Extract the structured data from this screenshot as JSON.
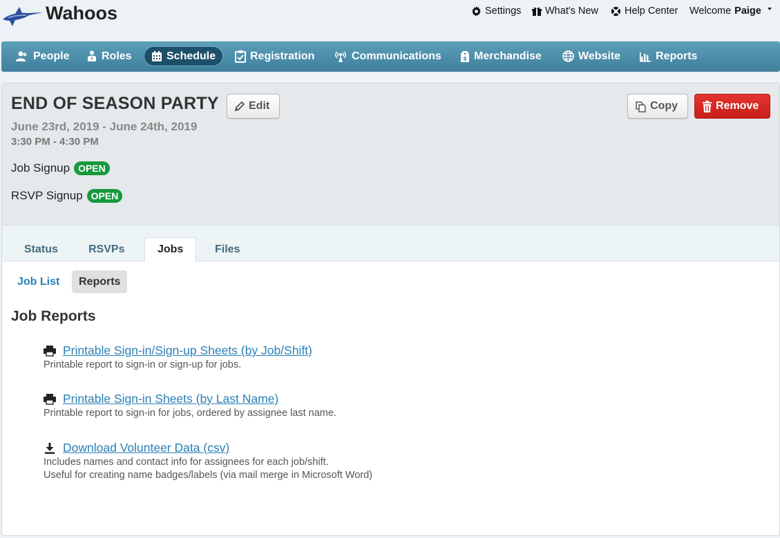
{
  "header": {
    "brand": "Wahoos",
    "settings": "Settings",
    "whats_new": "What's New",
    "help_center": "Help Center",
    "welcome": "Welcome",
    "user": "Paige"
  },
  "nav": {
    "items": [
      {
        "label": "People",
        "icon": "people-icon"
      },
      {
        "label": "Roles",
        "icon": "roles-icon"
      },
      {
        "label": "Schedule",
        "icon": "calendar-icon",
        "active": true
      },
      {
        "label": "Registration",
        "icon": "checklist-icon"
      },
      {
        "label": "Communications",
        "icon": "broadcast-icon"
      },
      {
        "label": "Merchandise",
        "icon": "price-tag-icon"
      },
      {
        "label": "Website",
        "icon": "globe-icon"
      },
      {
        "label": "Reports",
        "icon": "bar-chart-icon"
      }
    ]
  },
  "event": {
    "title": "END OF SEASON PARTY",
    "edit_label": "Edit",
    "copy_label": "Copy",
    "remove_label": "Remove",
    "date_range": "June 23rd, 2019 - June 24th, 2019",
    "time_range": "3:30 PM - 4:30 PM",
    "job_signup_label": "Job Signup",
    "job_signup_status": "OPEN",
    "rsvp_signup_label": "RSVP Signup",
    "rsvp_signup_status": "OPEN"
  },
  "tabs": [
    {
      "label": "Status"
    },
    {
      "label": "RSVPs"
    },
    {
      "label": "Jobs",
      "active": true
    },
    {
      "label": "Files"
    }
  ],
  "subtabs": [
    {
      "label": "Job List"
    },
    {
      "label": "Reports",
      "active": true
    }
  ],
  "reports": {
    "title": "Job Reports",
    "items": [
      {
        "icon": "printer-icon",
        "label": "Printable Sign-in/Sign-up Sheets (by Job/Shift)",
        "description": [
          "Printable report to sign-in or sign-up for jobs."
        ]
      },
      {
        "icon": "printer-icon",
        "label": "Printable Sign-in Sheets (by Last Name)",
        "description": [
          "Printable report to sign-in for jobs, ordered by assignee last name."
        ]
      },
      {
        "icon": "download-icon",
        "label": "Download Volunteer Data (csv)",
        "description": [
          "Includes names and contact info for assignees for each job/shift.",
          "Useful for creating name badges/labels (via mail merge in Microsoft Word)"
        ]
      }
    ]
  },
  "colors": {
    "nav_bg": "#4f91ae",
    "nav_active": "#1d4f6a",
    "link": "#2a7fb5",
    "badge_open": "#16993d",
    "remove": "#d42a25"
  }
}
